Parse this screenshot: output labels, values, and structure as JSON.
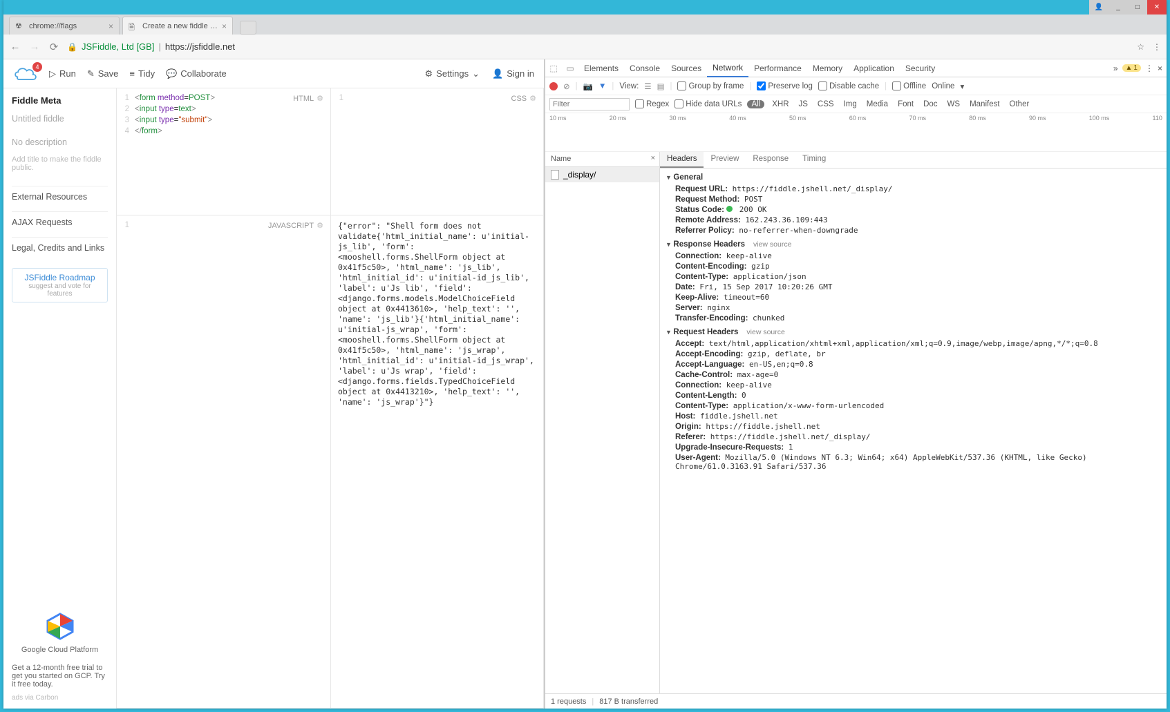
{
  "window": {
    "user": "👤",
    "min": "_",
    "max": "□",
    "close": "✕"
  },
  "tabs": [
    {
      "title": "chrome://flags",
      "active": false
    },
    {
      "title": "Create a new fiddle - JSF",
      "active": true
    }
  ],
  "omnibar": {
    "org": "JSFiddle, Ltd [GB]",
    "url_host": "https://jsfiddle.net"
  },
  "jsf": {
    "badge": "4",
    "run": "Run",
    "save": "Save",
    "tidy": "Tidy",
    "collab": "Collaborate",
    "settings": "Settings",
    "signin": "Sign in",
    "sidebar": {
      "meta": "Fiddle Meta",
      "title_ph": "Untitled fiddle",
      "desc_ph": "No description",
      "hint": "Add title to make the fiddle public.",
      "ext": "External Resources",
      "ajax": "AJAX Requests",
      "legal": "Legal, Credits and Links",
      "roadmap_t": "JSFiddle Roadmap",
      "roadmap_s": "suggest and vote for features",
      "ad_t": "Google Cloud Platform",
      "ad_b": "Get a 12-month free trial to get you started on GCP. Try it free today.",
      "carbon": "ads via Carbon"
    },
    "panes": {
      "html_label": "HTML",
      "css_label": "CSS",
      "js_label": "JAVASCRIPT",
      "html_lines": [
        "1",
        "2",
        "3",
        "4"
      ],
      "html_code": "<form method=POST>\n<input type=text>\n<input type=\"submit\">\n</form>",
      "result": "{\"error\": \"Shell form does not validate{'html_initial_name': u'initial-js_lib', 'form': <mooshell.forms.ShellForm object at 0x41f5c50>, 'html_name': 'js_lib', 'html_initial_id': u'initial-id_js_lib', 'label': u'Js lib', 'field': <django.forms.models.ModelChoiceField object at 0x4413610>, 'help_text': '', 'name': 'js_lib'}{'html_initial_name': u'initial-js_wrap', 'form': <mooshell.forms.ShellForm object at 0x41f5c50>, 'html_name': 'js_wrap', 'html_initial_id': u'initial-id_js_wrap', 'label': u'Js wrap', 'field': <django.forms.fields.TypedChoiceField object at 0x4413210>, 'help_text': '', 'name': 'js_wrap'}\"}"
    }
  },
  "devtools": {
    "tabs": [
      "Elements",
      "Console",
      "Sources",
      "Network",
      "Performance",
      "Memory",
      "Application",
      "Security"
    ],
    "active_tab": "Network",
    "more": "»",
    "warn_count": "1",
    "toolbar": {
      "view": "View:",
      "group": "Group by frame",
      "preserve": "Preserve log",
      "disable": "Disable cache",
      "offline": "Offline",
      "online": "Online"
    },
    "filter": {
      "ph": "Filter",
      "regex": "Regex",
      "hide": "Hide data URLs",
      "types": [
        "All",
        "XHR",
        "JS",
        "CSS",
        "Img",
        "Media",
        "Font",
        "Doc",
        "WS",
        "Manifest",
        "Other"
      ]
    },
    "timeline_ticks": [
      "10 ms",
      "20 ms",
      "30 ms",
      "40 ms",
      "50 ms",
      "60 ms",
      "70 ms",
      "80 ms",
      "90 ms",
      "100 ms",
      "110"
    ],
    "name_hdr": "Name",
    "request_name": "_display/",
    "detail_tabs": [
      "Headers",
      "Preview",
      "Response",
      "Timing"
    ],
    "general_h": "General",
    "general": [
      {
        "k": "Request URL:",
        "v": "https://fiddle.jshell.net/_display/"
      },
      {
        "k": "Request Method:",
        "v": "POST"
      },
      {
        "k": "Status Code:",
        "v": "200 OK",
        "status": true
      },
      {
        "k": "Remote Address:",
        "v": "162.243.36.109:443"
      },
      {
        "k": "Referrer Policy:",
        "v": "no-referrer-when-downgrade"
      }
    ],
    "resp_h": "Response Headers",
    "view_source": "view source",
    "response_headers": [
      {
        "k": "Connection:",
        "v": "keep-alive"
      },
      {
        "k": "Content-Encoding:",
        "v": "gzip"
      },
      {
        "k": "Content-Type:",
        "v": "application/json"
      },
      {
        "k": "Date:",
        "v": "Fri, 15 Sep 2017 10:20:26 GMT"
      },
      {
        "k": "Keep-Alive:",
        "v": "timeout=60"
      },
      {
        "k": "Server:",
        "v": "nginx"
      },
      {
        "k": "Transfer-Encoding:",
        "v": "chunked"
      }
    ],
    "req_h": "Request Headers",
    "request_headers": [
      {
        "k": "Accept:",
        "v": "text/html,application/xhtml+xml,application/xml;q=0.9,image/webp,image/apng,*/*;q=0.8"
      },
      {
        "k": "Accept-Encoding:",
        "v": "gzip, deflate, br"
      },
      {
        "k": "Accept-Language:",
        "v": "en-US,en;q=0.8"
      },
      {
        "k": "Cache-Control:",
        "v": "max-age=0"
      },
      {
        "k": "Connection:",
        "v": "keep-alive"
      },
      {
        "k": "Content-Length:",
        "v": "0"
      },
      {
        "k": "Content-Type:",
        "v": "application/x-www-form-urlencoded"
      },
      {
        "k": "Host:",
        "v": "fiddle.jshell.net"
      },
      {
        "k": "Origin:",
        "v": "https://fiddle.jshell.net"
      },
      {
        "k": "Referer:",
        "v": "https://fiddle.jshell.net/_display/"
      },
      {
        "k": "Upgrade-Insecure-Requests:",
        "v": "1"
      },
      {
        "k": "User-Agent:",
        "v": "Mozilla/5.0 (Windows NT 6.3; Win64; x64) AppleWebKit/537.36 (KHTML, like Gecko) Chrome/61.0.3163.91 Safari/537.36"
      }
    ],
    "status": {
      "reqs": "1 requests",
      "xfer": "817 B transferred"
    }
  }
}
